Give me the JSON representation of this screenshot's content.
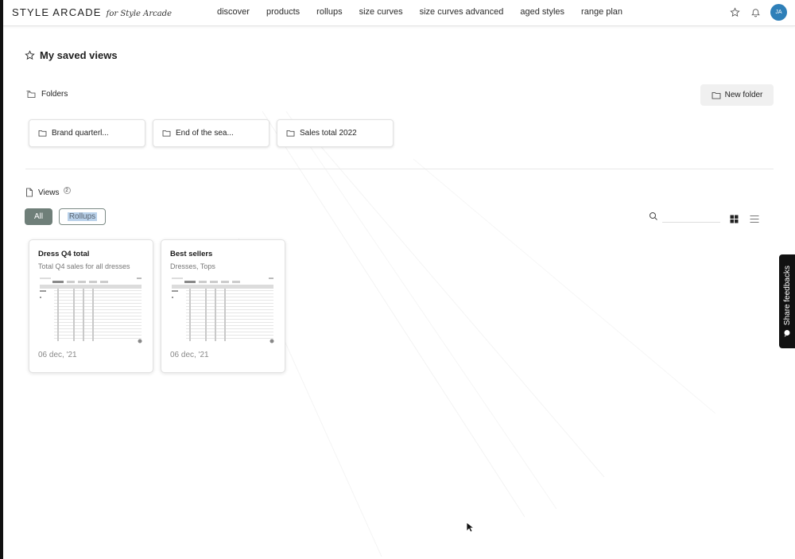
{
  "brand": {
    "name": "STYLE ARCADE",
    "script": "for Style Arcade"
  },
  "nav": [
    "discover",
    "products",
    "rollups",
    "size curves",
    "size curves advanced",
    "aged styles",
    "range plan"
  ],
  "user": {
    "initials": "JA",
    "avatar_color": "#2e7fb8"
  },
  "page": {
    "title": "My saved views"
  },
  "folders": {
    "heading": "Folders",
    "new_button": "New folder",
    "items": [
      "Brand quarterl...",
      "End of the sea...",
      "Sales total 2022"
    ]
  },
  "views": {
    "heading": "Views",
    "count": "2",
    "filters": {
      "all": "All",
      "rollups": "Rollups"
    },
    "search_placeholder": "",
    "items": [
      {
        "title": "Dress Q4 total",
        "subtitle": "Total Q4 sales for all dresses",
        "date": "06 dec, '21"
      },
      {
        "title": "Best sellers",
        "subtitle": "Dresses, Tops",
        "date": "06 dec, '21"
      }
    ]
  },
  "feedback": {
    "label": "Share feedbacks"
  },
  "colors": {
    "accent": "#6f7f79",
    "selection": "#b9d1ea",
    "feedback_bg": "#111111"
  }
}
